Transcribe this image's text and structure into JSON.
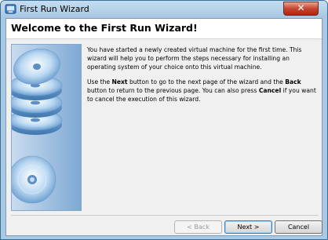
{
  "window": {
    "title": "First Run Wizard",
    "close_glyph": "✕"
  },
  "header": {
    "title": "Welcome to the First Run Wizard!"
  },
  "body": {
    "p1": "You have started a newly created virtual machine for the first time. This wizard will help you to perform the steps necessary for installing an operating system of your choice onto this virtual machine.",
    "p2_a": "Use the ",
    "p2_next": "Next",
    "p2_b": " button to go to the next page of the wizard and the ",
    "p2_back": "Back",
    "p2_c": " button to return to the previous page. You can also press ",
    "p2_cancel": "Cancel",
    "p2_d": " if you want to cancel the execution of this wizard."
  },
  "buttons": {
    "back": "< Back",
    "next": "Next >",
    "cancel": "Cancel"
  },
  "icons": {
    "app": "virtualbox-icon",
    "side": "disc-stack-icon"
  }
}
